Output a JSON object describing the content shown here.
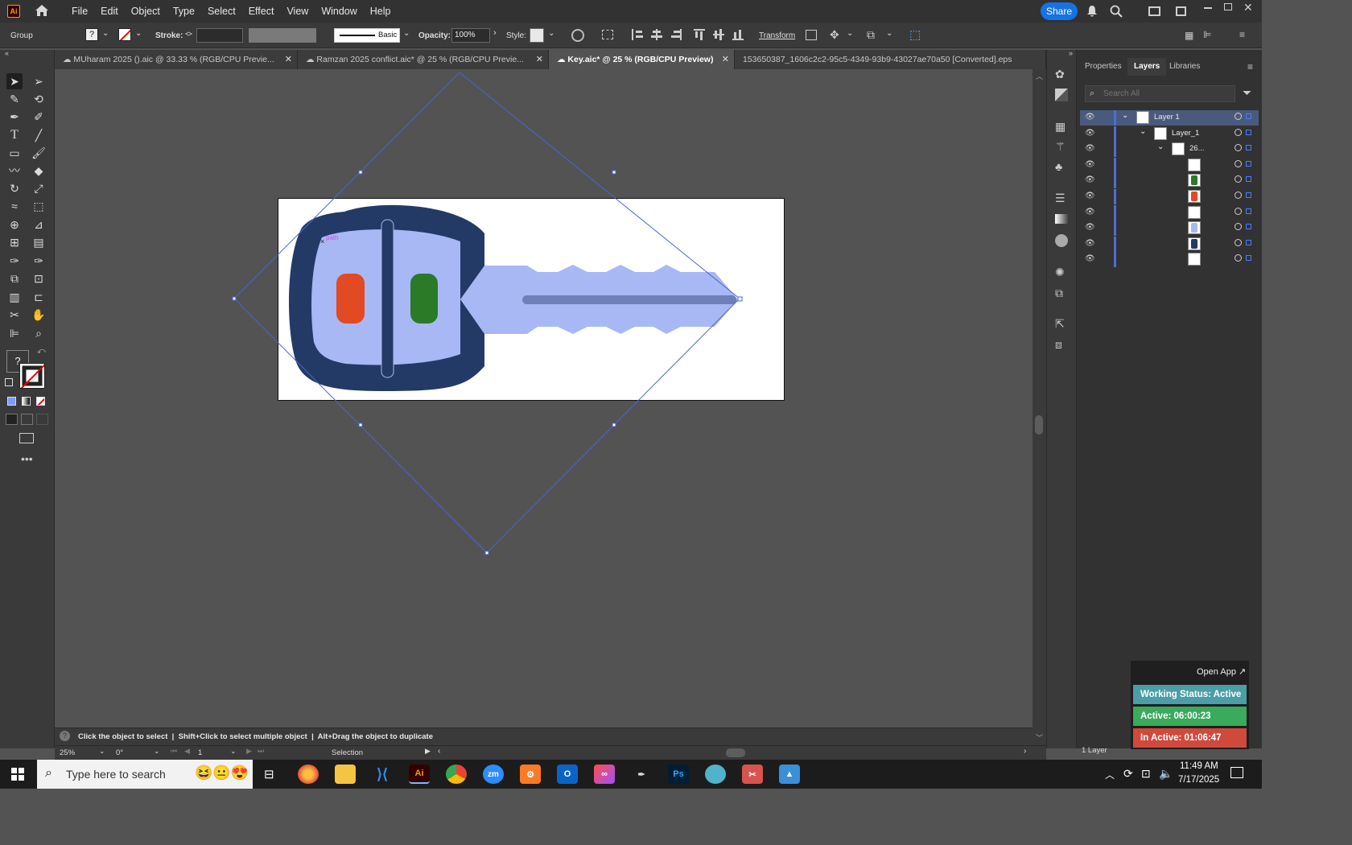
{
  "app": {
    "logo": "Ai",
    "home_icon": "home-icon"
  },
  "menu": [
    "File",
    "Edit",
    "Object",
    "Type",
    "Select",
    "Effect",
    "View",
    "Window",
    "Help"
  ],
  "share_label": "Share",
  "controlbar": {
    "selection_type": "Group",
    "stroke_label": "Stroke:",
    "brush_label": "Basic",
    "opacity_label": "Opacity:",
    "opacity_value": "100%",
    "style_label": "Style:",
    "transform_label": "Transform",
    "fill_indicator": "?"
  },
  "tabs": [
    {
      "label": "MUharam 2025 ().aic @ 33.33 % (RGB/CPU Previe...",
      "cloud": true
    },
    {
      "label": "Ramzan 2025 conflict.aic* @ 25 % (RGB/CPU Previe...",
      "cloud": true
    },
    {
      "label": "Key.aic* @ 25 % (RGB/CPU Preview)",
      "cloud": true,
      "active": true
    },
    {
      "label": "153650387_1606c2c2-95c5-4349-93b9-43027ae70a50 [Converted].eps",
      "cloud": false
    }
  ],
  "artboard": {
    "hover_label": "path",
    "colors": {
      "key_dark": "#243a66",
      "key_light": "#a7b8f4",
      "red_button": "#e14a22",
      "green_button": "#2a7a28",
      "groove": "#6f7fb8",
      "selection": "#4a63d6"
    }
  },
  "panel": {
    "tabs": [
      "Properties",
      "Layers",
      "Libraries"
    ],
    "search_placeholder": "Search All",
    "layers": [
      {
        "name": "Layer 1",
        "indent": 0,
        "expanded": true
      },
      {
        "name": "Layer_1",
        "indent": 1,
        "expanded": true
      },
      {
        "name": "26...",
        "indent": 2,
        "expanded": true
      },
      {
        "name": "",
        "indent": 3,
        "swatch": "#ffffff"
      },
      {
        "name": "",
        "indent": 3,
        "swatch": "#2a7a28"
      },
      {
        "name": "",
        "indent": 3,
        "swatch": "#e14a22"
      },
      {
        "name": "",
        "indent": 3,
        "swatch": "#ffffff"
      },
      {
        "name": "",
        "indent": 3,
        "swatch": "#a7b8f4"
      },
      {
        "name": "",
        "indent": 3,
        "swatch": "#243a66"
      },
      {
        "name": "",
        "indent": 3,
        "swatch": "#ffffff"
      }
    ],
    "footer_count": "1 Layer"
  },
  "statusbar": {
    "hint": "Click the object to select  |  Shift+Click to select multiple object  |  Alt+Drag the object to duplicate",
    "zoom": "25%",
    "rotation": "0°",
    "artboard_number": "1",
    "tool": "Selection"
  },
  "tracker": {
    "open_app": "Open App ↗",
    "working_status": "Working Status: Active",
    "active": "Active: 06:00:23",
    "inactive": "In Active: 01:06:47",
    "colors": {
      "status": "#4b9ea6",
      "active": "#3aaa5c",
      "inactive": "#cf4a3c"
    }
  },
  "taskbar": {
    "search_placeholder": "Type here to search",
    "time": "11:49 AM",
    "date": "7/17/2025"
  }
}
